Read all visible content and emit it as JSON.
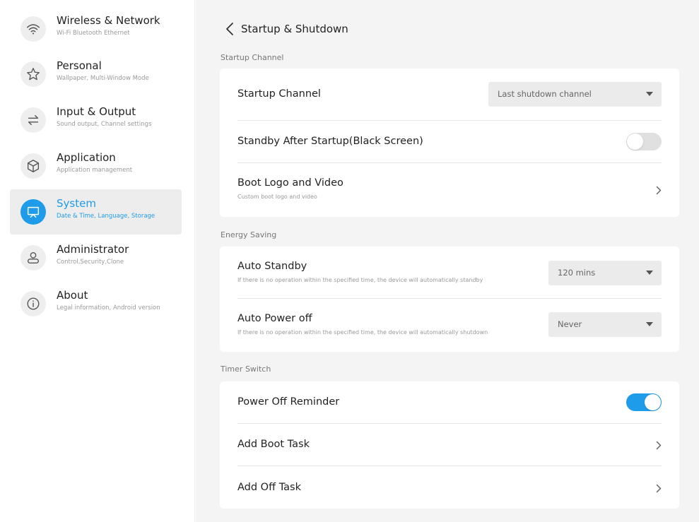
{
  "colors": {
    "accent": "#1e9be9",
    "active_bg": "#ededed",
    "main_bg": "#f4f4f4"
  },
  "sidebar": {
    "items": [
      {
        "icon": "wifi-icon",
        "title": "Wireless & Network",
        "subtitle": "Wi-Fi Bluetooth Ethernet",
        "active": false
      },
      {
        "icon": "star-icon",
        "title": "Personal",
        "subtitle": "Wallpaper, Multi-Window Mode",
        "active": false
      },
      {
        "icon": "swap-arrows-icon",
        "title": "Input & Output",
        "subtitle": "Sound output, Channel settings",
        "active": false
      },
      {
        "icon": "cube-icon",
        "title": "Application",
        "subtitle": "Application management",
        "active": false
      },
      {
        "icon": "monitor-icon",
        "title": "System",
        "subtitle": "Date & Time, Language, Storage",
        "active": true
      },
      {
        "icon": "user-icon",
        "title": "Administrator",
        "subtitle": "Control,Security,Clone",
        "active": false
      },
      {
        "icon": "info-icon",
        "title": "About",
        "subtitle": "Legal information, Android version",
        "active": false
      }
    ]
  },
  "header": {
    "back_icon": "chevron-left-icon",
    "title": "Startup & Shutdown"
  },
  "sections": {
    "startup": {
      "label": "Startup Channel",
      "startup_channel": {
        "title": "Startup Channel",
        "value": "Last shutdown channel"
      },
      "standby_after_startup": {
        "title": "Standby After Startup(Black Screen)",
        "on": false
      },
      "boot_logo": {
        "title": "Boot Logo and Video",
        "subtitle": "Custom boot logo and video"
      }
    },
    "energy": {
      "label": "Energy Saving",
      "auto_standby": {
        "title": "Auto Standby",
        "subtitle": "If there is no operation within the specified time, the device will automatically standby",
        "value": "120 mins"
      },
      "auto_power_off": {
        "title": "Auto Power off",
        "subtitle": "If there is no operation within the specified time, the device will automatically shutdown",
        "value": "Never"
      }
    },
    "timer": {
      "label": "Timer Switch",
      "power_off_reminder": {
        "title": "Power Off Reminder",
        "on": true
      },
      "add_boot_task": {
        "title": "Add Boot Task"
      },
      "add_off_task": {
        "title": "Add Off Task"
      }
    }
  }
}
